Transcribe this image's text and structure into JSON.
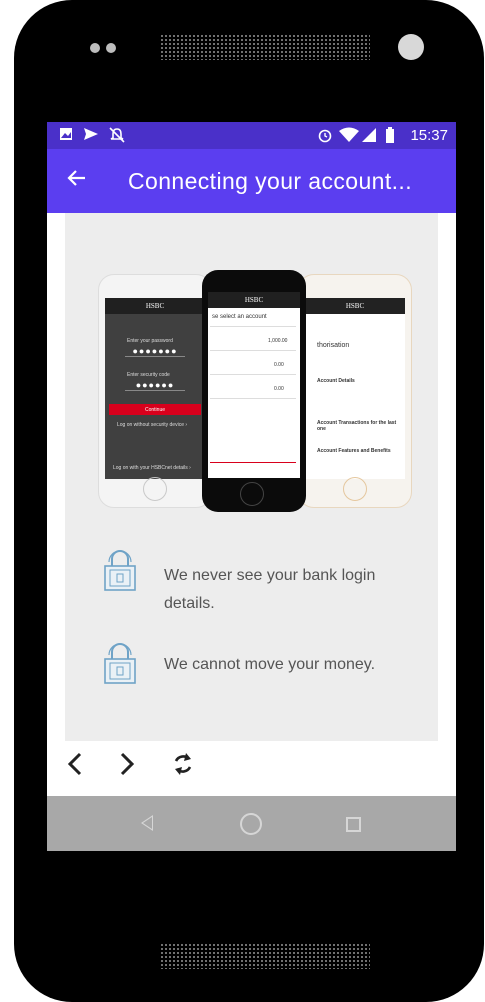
{
  "status_bar": {
    "time": "15:37",
    "left_icons": [
      "image-icon",
      "send-icon",
      "notifications-off-icon"
    ],
    "right_icons": [
      "alarm-icon",
      "wifi-icon",
      "signal-icon",
      "battery-icon"
    ]
  },
  "app_bar": {
    "back_icon": "arrow-left-icon",
    "title": "Connecting your account..."
  },
  "hero": {
    "phone_left": {
      "bank": "HSBC",
      "password_label": "Enter your password",
      "password_mask": "●●●●●●●",
      "code_label": "Enter security code",
      "code_mask": "●●●●●●",
      "button": "Continue",
      "link1": "Log on without security device ›",
      "link2": "Log on with your HSBCnet details ›"
    },
    "phone_center": {
      "bank": "HSBC",
      "heading": "se select an account",
      "rows": [
        "1,000.00",
        "0.00",
        "0.00"
      ]
    },
    "phone_right": {
      "bank": "HSBC",
      "heading": "thorisation",
      "items": [
        "Account Details",
        "Account Transactions for the last one",
        "Account Features and Benefits"
      ]
    }
  },
  "features": [
    {
      "icon": "padlock-icon",
      "text_line1": "We never see your bank login",
      "text_line2": "details."
    },
    {
      "icon": "padlock-icon",
      "text_line1": "We cannot move your money.",
      "text_line2": ""
    }
  ],
  "nav_controls": {
    "back": "‹",
    "forward": "›",
    "refresh": "↻"
  },
  "colors": {
    "status_bar": "#4a30c9",
    "app_bar": "#5b3ef0",
    "content_bg": "#ededed",
    "system_nav": "#a8a8a8",
    "lock_icon": "#6fa3c7"
  }
}
